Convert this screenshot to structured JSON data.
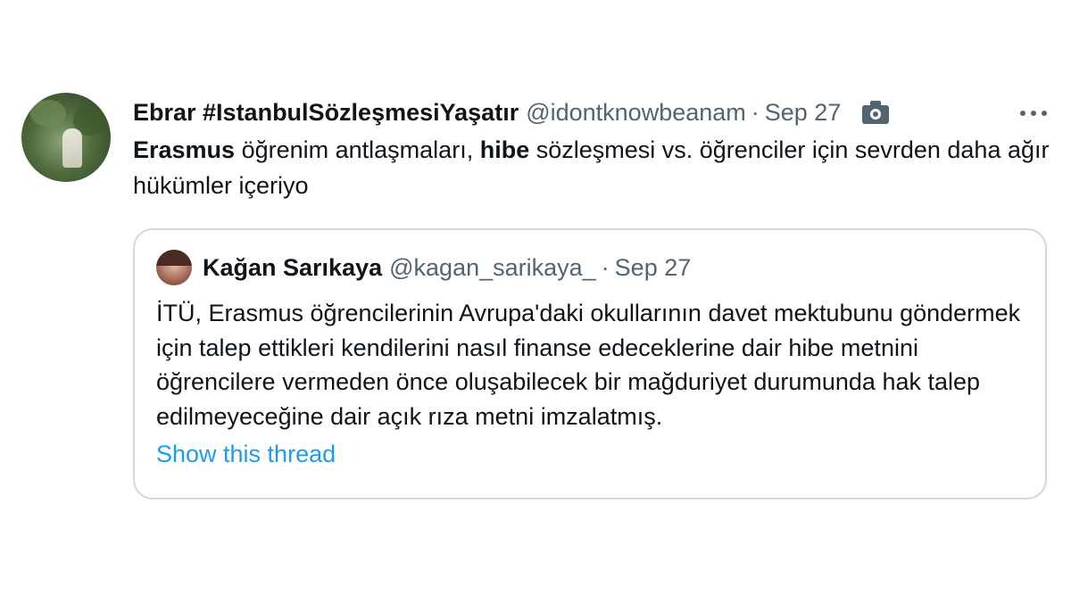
{
  "tweet": {
    "display_name": "Ebrar #IstanbulSözleşmesiYaşatır",
    "handle": "@idontknowbeanam",
    "separator": "·",
    "date": "Sep 27",
    "media_icon": "camera-icon",
    "more_icon": "more-icon",
    "text": {
      "bold1": "Erasmus",
      "part1": " öğrenim antlaşmaları, ",
      "bold2": "hibe",
      "part2": " sözleşmesi vs. öğrenciler için sevrden daha ağır hükümler içeriyo"
    }
  },
  "quote": {
    "display_name": "Kağan Sarıkaya",
    "handle": "@kagan_sarikaya_",
    "separator": "·",
    "date": "Sep 27",
    "text": "İTÜ, Erasmus öğrencilerinin Avrupa'daki okullarının davet mektubunu göndermek için talep ettikleri kendilerini nasıl finanse edeceklerine dair hibe metnini öğrencilere vermeden önce oluşabilecek bir mağduriyet durumunda hak talep edilmeyeceğine dair açık rıza metni imzalatmış.",
    "show_thread": "Show this thread"
  },
  "colors": {
    "text_primary": "#0f1419",
    "text_secondary": "#536471",
    "link": "#1d9bf0",
    "border": "#cfd9de"
  }
}
